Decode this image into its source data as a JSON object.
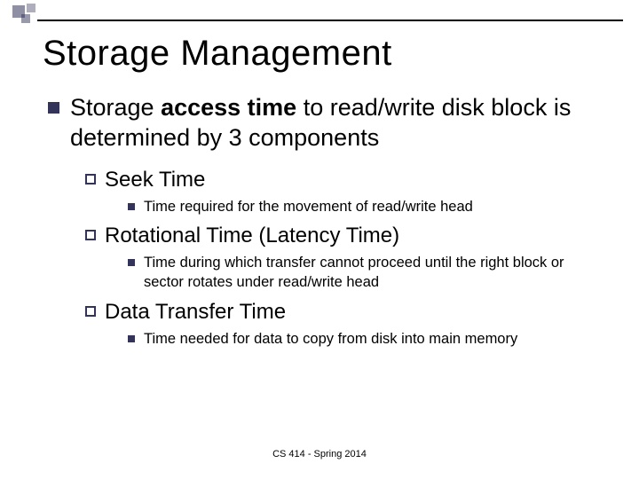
{
  "title": "Storage Management",
  "main_point": {
    "prefix": "Storage ",
    "bold": "access time",
    "suffix": " to read/write disk block is determined by 3 components"
  },
  "items": [
    {
      "heading": "Seek Time",
      "detail": "Time required for the movement of read/write head"
    },
    {
      "heading": "Rotational Time (Latency Time)",
      "detail": "Time during which transfer cannot proceed until the right block or sector rotates under read/write head"
    },
    {
      "heading": "Data Transfer Time",
      "detail": "Time needed for data to copy from disk into main memory"
    }
  ],
  "footer": "CS 414 - Spring 2014"
}
